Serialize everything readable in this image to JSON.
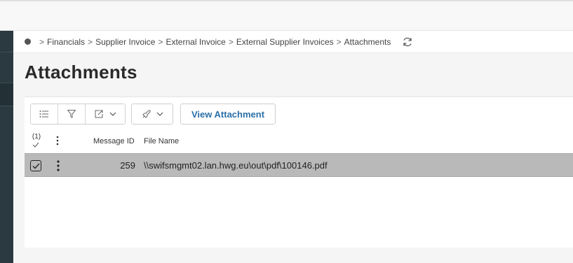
{
  "breadcrumb": {
    "items": [
      "Financials",
      "Supplier Invoice",
      "External Invoice",
      "External Supplier Invoices",
      "Attachments"
    ],
    "separator": ">"
  },
  "page": {
    "title": "Attachments"
  },
  "toolbar": {
    "view_attachment_label": "View Attachment"
  },
  "table": {
    "selected_count": "(1)",
    "columns": [
      "Message ID",
      "File Name"
    ],
    "rows": [
      {
        "message_id": "259",
        "file_name": "\\\\swifsmgmt02.lan.hwg.eu\\out\\pdf\\100146.pdf"
      }
    ]
  },
  "colors": {
    "sidebar": "#2b3a40",
    "accent": "#2b6fa8",
    "selected_row": "#b9b9b9"
  }
}
